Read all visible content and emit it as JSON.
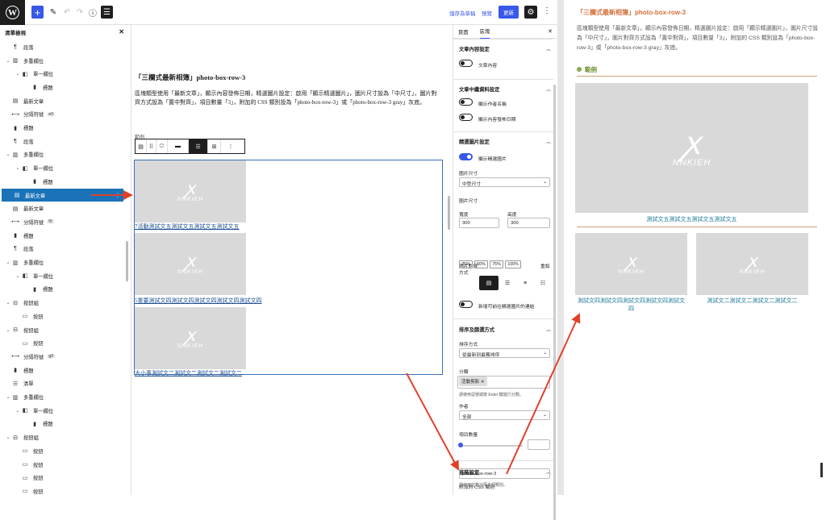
{
  "topbar": {
    "save_draft": "儲存為草稿",
    "preview": "預覽",
    "update": "更新"
  },
  "listview": {
    "title": "清單檢視",
    "items": [
      {
        "label": "段落",
        "icon": "¶",
        "indent": 0,
        "toggle": ""
      },
      {
        "label": "多重欄位",
        "icon": "▥",
        "indent": 0,
        "toggle": "⌄"
      },
      {
        "label": "單一欄位",
        "icon": "◧",
        "indent": 1,
        "toggle": "⌄"
      },
      {
        "label": "標題",
        "icon": "▮",
        "indent": 2,
        "toggle": ""
      },
      {
        "label": "最新文章",
        "icon": "▤",
        "indent": 0,
        "toggle": ""
      },
      {
        "label": "分隔符號",
        "icon": "⟷",
        "indent": 0,
        "toggle": "",
        "badge": "e0"
      },
      {
        "label": "標題",
        "icon": "▮",
        "indent": 0,
        "toggle": ""
      },
      {
        "label": "段落",
        "icon": "¶",
        "indent": 0,
        "toggle": ""
      },
      {
        "label": "多重欄位",
        "icon": "▥",
        "indent": 0,
        "toggle": "⌄"
      },
      {
        "label": "單一欄位",
        "icon": "◧",
        "indent": 1,
        "toggle": "⌄"
      },
      {
        "label": "標題",
        "icon": "▮",
        "indent": 2,
        "toggle": ""
      },
      {
        "label": "最新文章",
        "icon": "▤",
        "indent": 0,
        "toggle": "",
        "selected": true
      },
      {
        "label": "最新文章",
        "icon": "▤",
        "indent": 0,
        "toggle": ""
      },
      {
        "label": "分隔符號",
        "icon": "⟷",
        "indent": 0,
        "toggle": "",
        "badge": "f0"
      },
      {
        "label": "標題",
        "icon": "▮",
        "indent": 0,
        "toggle": ""
      },
      {
        "label": "段落",
        "icon": "¶",
        "indent": 0,
        "toggle": ""
      },
      {
        "label": "多重欄位",
        "icon": "▥",
        "indent": 0,
        "toggle": "⌄"
      },
      {
        "label": "單一欄位",
        "icon": "◧",
        "indent": 1,
        "toggle": "⌄"
      },
      {
        "label": "標題",
        "icon": "▮",
        "indent": 2,
        "toggle": ""
      },
      {
        "label": "按鈕組",
        "icon": "⊟",
        "indent": 0,
        "toggle": "⌄"
      },
      {
        "label": "按鈕",
        "icon": "▭",
        "indent": 1,
        "toggle": ""
      },
      {
        "label": "按鈕組",
        "icon": "⊟",
        "indent": 0,
        "toggle": "⌄"
      },
      {
        "label": "按鈕",
        "icon": "▭",
        "indent": 1,
        "toggle": ""
      },
      {
        "label": "分隔符號",
        "icon": "⟷",
        "indent": 0,
        "toggle": "",
        "badge": "g0"
      },
      {
        "label": "標題",
        "icon": "▮",
        "indent": 0,
        "toggle": ""
      },
      {
        "label": "清單",
        "icon": "☰",
        "indent": 0,
        "toggle": ""
      },
      {
        "label": "多重欄位",
        "icon": "▥",
        "indent": 0,
        "toggle": "⌄"
      },
      {
        "label": "單一欄位",
        "icon": "◧",
        "indent": 1,
        "toggle": "⌄"
      },
      {
        "label": "標題",
        "icon": "▮",
        "indent": 2,
        "toggle": ""
      },
      {
        "label": "按鈕組",
        "icon": "⊟",
        "indent": 0,
        "toggle": "⌄"
      },
      {
        "label": "按鈕",
        "icon": "▭",
        "indent": 1,
        "toggle": ""
      },
      {
        "label": "按鈕",
        "icon": "▭",
        "indent": 1,
        "toggle": ""
      },
      {
        "label": "按鈕",
        "icon": "▭",
        "indent": 1,
        "toggle": ""
      },
      {
        "label": "按鈕",
        "icon": "▭",
        "indent": 1,
        "toggle": ""
      }
    ]
  },
  "canvas": {
    "heading": "「三欄式最新相簿」photo-box-row-3",
    "description": "區塊類型使用「最新文章」，顯示內容發佈日期，精選圖片設定：啟用「顯示精選圖片」，圖片尺寸設為「中尺寸」，圖片對齊方式設為「置中對齊」，項目數量「3」，附加的 CSS 類別設為「photo-box-row-3」或「photo-box-row-3 gray」灰底。",
    "small_label": "範例",
    "logo_text": "NNKIEH",
    "posts": [
      "7活動測試文五測試文五測試文五測試文五",
      "5重要測試文四測試文四測試文四測試文四測試文四",
      "大小事測試文二測試文二測試文二測試文二"
    ]
  },
  "settings": {
    "tabs": [
      "頁面",
      "區塊"
    ],
    "content_section": "文章內容設定",
    "content_toggle": "文章內容",
    "meta_section": "文章中繼資料設定",
    "author_toggle": "顯示作者名稱",
    "date_toggle": "顯示內容發佈日期",
    "featured_section": "精選圖片設定",
    "featured_toggle": "顯示精選圖片",
    "image_size_label": "圖片尺寸",
    "image_size_value": "中型尺寸",
    "image_dim_label": "圖片尺寸",
    "width_label": "寬度",
    "height_label": "高度",
    "width_value": "300",
    "height_value": "300",
    "percents": [
      "25%",
      "50%",
      "75%",
      "100%"
    ],
    "reset": "重設",
    "align_label": "圖片對齊方式",
    "link_toggle": "新增可前往精選圖片的連結",
    "sort_section": "排序及篩選方式",
    "sort_label": "排序方式",
    "sort_value": "從最新到最舊排序",
    "category_label": "分類",
    "category_chip": "活動剪影 ✕",
    "category_help": "請使用逗號或按 Enter 鍵進行分類。",
    "author_label": "作者",
    "author_value": "全部",
    "count_label": "項目數量",
    "advanced_section": "進階設定",
    "css_label": "附加的 CSS 類別",
    "css_value": "photo-box-row-3",
    "css_help": "請使用空格分隔多個類別。"
  },
  "preview": {
    "title": "「三欄式最新相簿」photo-box-row-3",
    "description": "區塊類型使用「最新文章」，顯示內容發佈日期，精選圖片設定：啟用「顯示精選圖片」，圖片尺寸設為「中尺寸」，圖片對齊方式設為「置中對齊」，項目數量「3」，附加的 CSS 類別設為「photo-box-row-3」或「photo-box-row-3 gray」灰底。",
    "example_label": "範例",
    "caption_main": "測試文五測試文五測試文五測試文五",
    "caption_left": "測試文四測試文四測試文四測試文四測試文四",
    "caption_right": "測試文二測試文二測試文二測試文二",
    "logo_text": "NNKIEH"
  },
  "colors": {
    "accent": "#3858e9",
    "selected": "#1a73b8",
    "arrow": "#e0402a",
    "preview_title": "#d4713b",
    "caption": "#1d7a99"
  }
}
